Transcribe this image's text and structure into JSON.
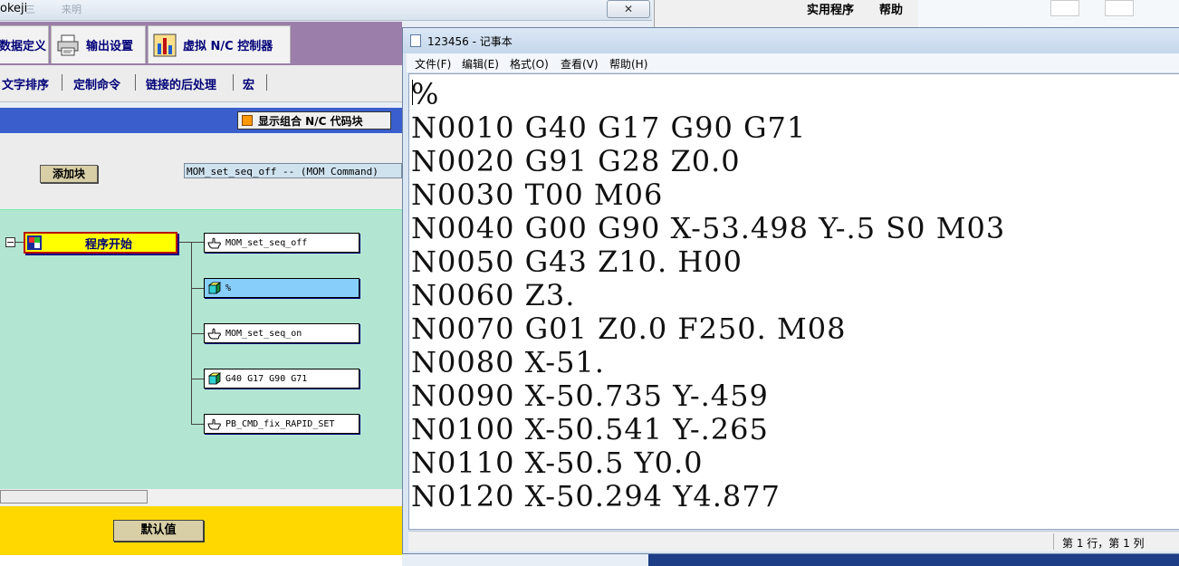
{
  "background_app": {
    "title_fragment": "okeji",
    "title_faded_1": "三",
    "title_faded_2": "来明",
    "close_symbol": "✕",
    "tabs": [
      {
        "label": "数据定义",
        "icon": "data-definition-icon"
      },
      {
        "label": "输出设置",
        "icon": "printer-icon"
      },
      {
        "label": "虚拟 N/C 控制器",
        "icon": "virtual-nc-controller-icon"
      }
    ],
    "subtabs": [
      "文字排序",
      "定制命令",
      "链接的后处理",
      "宏"
    ],
    "show_combined_label": "显示组合 N/C 代码块",
    "add_block_label": "添加块",
    "command_field_value": "MOM_set_seq_off -- (MOM Command)",
    "program_start_label": "程序开始",
    "tree_nodes": [
      {
        "label": "MOM_set_seq_off",
        "icon": "hand-pointer-icon",
        "selected": false
      },
      {
        "label": "%",
        "icon": "block-cube-icon",
        "selected": true
      },
      {
        "label": "MOM_set_seq_on",
        "icon": "hand-pointer-icon",
        "selected": false
      },
      {
        "label": "G40 G17 G90 G71",
        "icon": "block-cube-icon",
        "selected": false
      },
      {
        "label": "PB_CMD_fix_RAPID_SET",
        "icon": "hand-pointer-icon",
        "selected": false
      }
    ],
    "default_label": "默认值",
    "collapse_symbol": "−"
  },
  "right_background": {
    "menu_items": [
      "实用程序",
      "帮助"
    ]
  },
  "notepad": {
    "title": "123456 - 记事本",
    "menu": [
      "文件(F)",
      "编辑(E)",
      "格式(O)",
      "查看(V)",
      "帮助(H)"
    ],
    "lines": [
      "%",
      "N0010 G40 G17 G90 G71",
      "N0020 G91 G28 Z0.0",
      "N0030 T00 M06",
      "N0040 G00 G90 X-53.498 Y-.5 S0 M03",
      "N0050 G43 Z10. H00",
      "N0060 Z3.",
      "N0070 G01 Z0.0 F250. M08",
      "N0080 X-51.",
      "N0090 X-50.735 Y-.459",
      "N0100 X-50.541 Y-.265",
      "N0110 X-50.5 Y0.0",
      "N0120 X-50.294 Y4.877"
    ],
    "status": "第 1 行，第 1 列"
  },
  "colors": {
    "tab_bar": "#9b7eaa",
    "blue_band": "#3a5fcd",
    "tree_bg": "#b3e6d2",
    "program_start_bg": "#ffff00",
    "selected_node": "#87cefa",
    "footer_bar": "#ffd800"
  }
}
